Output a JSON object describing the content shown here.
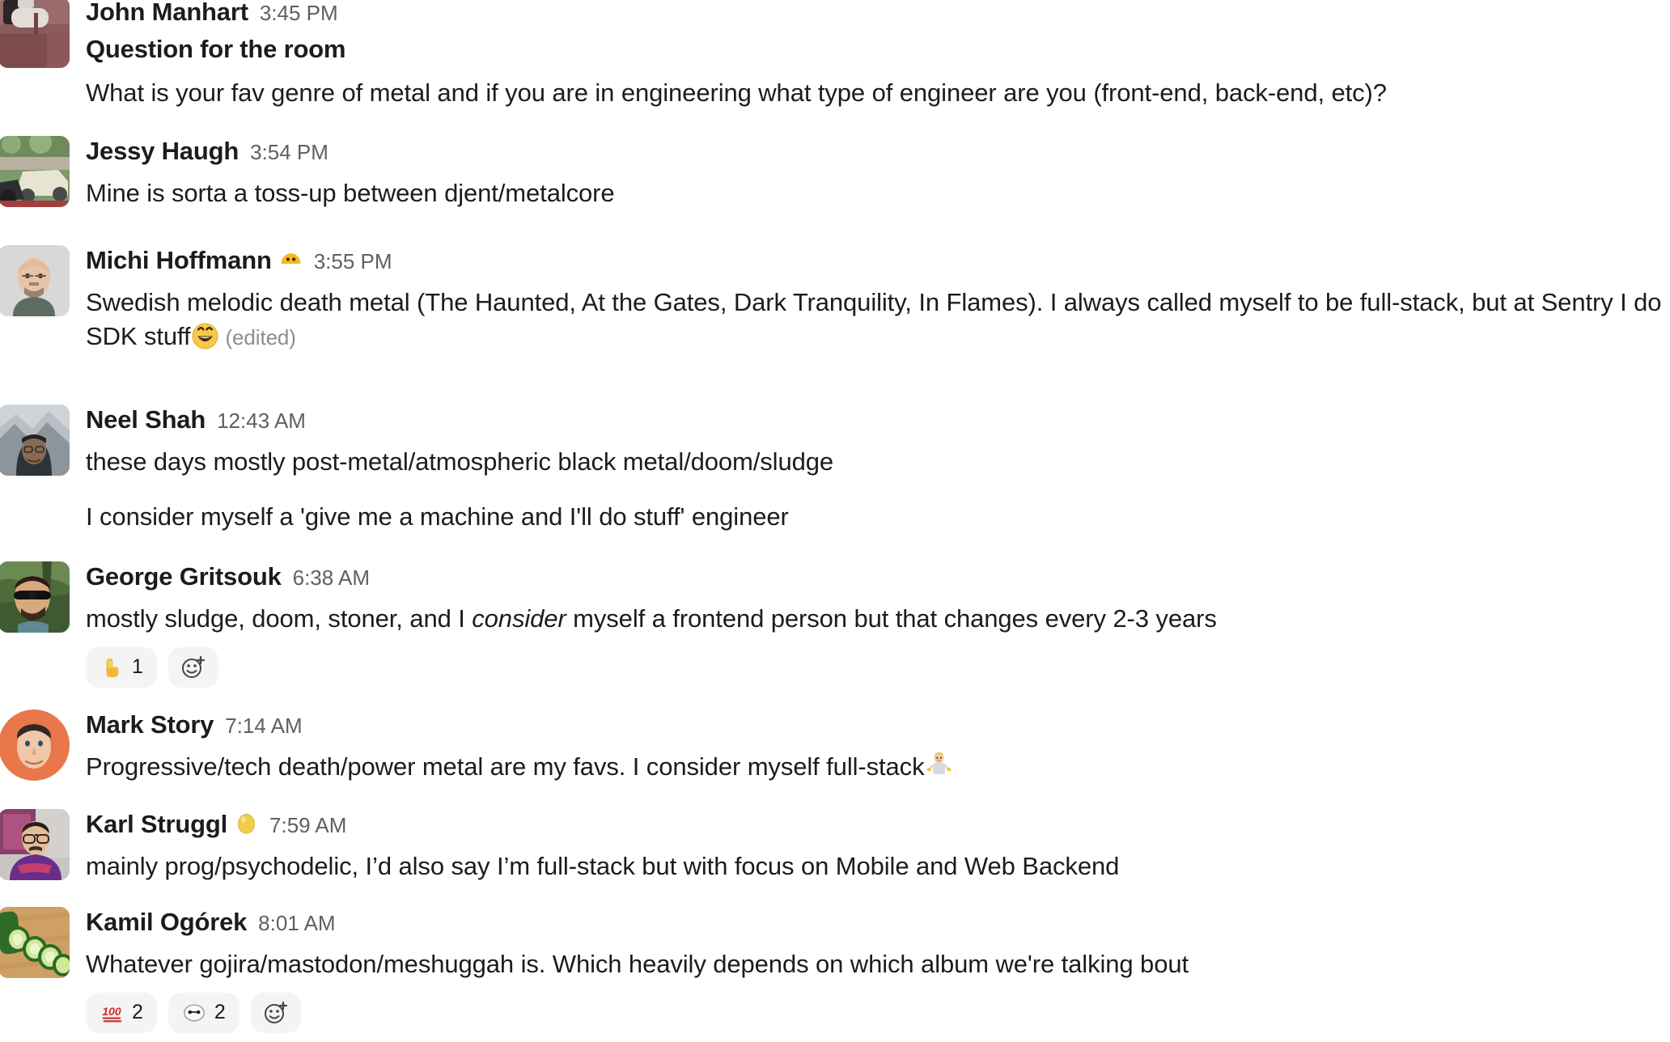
{
  "channel": {
    "messages": [
      {
        "id": "msg-john-manhart",
        "author": "John Manhart",
        "timestamp": "3:45 PM",
        "status_emoji": null,
        "avatar": "vr-headset-photo",
        "heading": "Question for the room",
        "paragraphs": [
          "What is your fav genre of metal and if you are in engineering what type of engineer are you (front-end, back-end, etc)?"
        ],
        "edited": false,
        "reactions": []
      },
      {
        "id": "msg-jessy-haugh",
        "author": "Jessy Haugh",
        "timestamp": "3:54 PM",
        "status_emoji": null,
        "avatar": "car-motorcycle-photo",
        "heading": null,
        "paragraphs": [
          "Mine is sorta a toss-up between djent/metalcore"
        ],
        "edited": false,
        "reactions": []
      },
      {
        "id": "msg-michi-hoffmann",
        "author": "Michi Hoffmann",
        "timestamp": "3:55 PM",
        "status_emoji": "partial-smiley-status",
        "avatar": "bald-bearded-man-photo",
        "heading": null,
        "paragraphs": [
          "Swedish melodic death metal (The Haunted, At the Gates, Dark Tranquility, In Flames). I always called myself to be full-stack, but at Sentry I do SDK stuff"
        ],
        "trailing_emoji": "grinning-face-with-smiling-eyes",
        "edited": true,
        "edited_label": "(edited)",
        "reactions": []
      },
      {
        "id": "msg-neel-shah",
        "author": "Neel Shah",
        "timestamp": "12:43 AM",
        "status_emoji": null,
        "avatar": "mountain-hoodie-photo",
        "heading": null,
        "paragraphs": [
          "these days mostly post-metal/atmospheric black metal/doom/sludge",
          "I consider myself a 'give me a machine and I'll do stuff' engineer"
        ],
        "edited": false,
        "reactions": []
      },
      {
        "id": "msg-george-gritsouk",
        "author": "George Gritsouk",
        "timestamp": "6:38 AM",
        "status_emoji": null,
        "avatar": "sunglasses-outdoors-photo",
        "heading": null,
        "rich_parts": [
          {
            "text": "mostly sludge, doom, stoner, and I ",
            "italic": false
          },
          {
            "text": "consider",
            "italic": true
          },
          {
            "text": " myself a frontend person but that changes every 2-3 years",
            "italic": false
          }
        ],
        "edited": false,
        "reactions": [
          {
            "emoji": "index-pointing-up",
            "count": "1",
            "selected": false
          }
        ],
        "add_reaction": true
      },
      {
        "id": "msg-mark-story",
        "author": "Mark Story",
        "timestamp": "7:14 AM",
        "status_emoji": null,
        "avatar": "orange-circle-caricature",
        "heading": null,
        "paragraphs": [
          "Progressive/tech death/power metal are my favs. I consider myself full-stack"
        ],
        "trailing_emoji": "man-shrugging",
        "edited": false,
        "reactions": []
      },
      {
        "id": "msg-karl-struggl",
        "author": "Karl Struggl",
        "timestamp": "7:59 AM",
        "status_emoji": "yellow-egg-status",
        "avatar": "glasses-purple-hoodie-photo",
        "heading": null,
        "paragraphs": [
          "mainly prog/psychodelic, I’d also say I’m full-stack but with focus on Mobile and Web Backend"
        ],
        "edited": false,
        "reactions": []
      },
      {
        "id": "msg-kamil-ogorek",
        "author": "Kamil Ogórek",
        "timestamp": "8:01 AM",
        "status_emoji": null,
        "avatar": "sliced-cucumber-photo",
        "heading": null,
        "paragraphs": [
          "Whatever gojira/mastodon/meshuggah is. Which heavily depends on which album we're talking bout"
        ],
        "edited": false,
        "reactions": [
          {
            "emoji": "hundred-points",
            "count": "2",
            "selected": false
          },
          {
            "emoji": "baymax-face",
            "count": "2",
            "selected": false
          }
        ],
        "add_reaction": true
      }
    ]
  },
  "colors": {
    "text_primary": "#1d1c1d",
    "text_muted": "#616061",
    "text_edited": "#8d8d8e",
    "chip_background": "#f4f4f4",
    "page_background": "#ffffff"
  }
}
